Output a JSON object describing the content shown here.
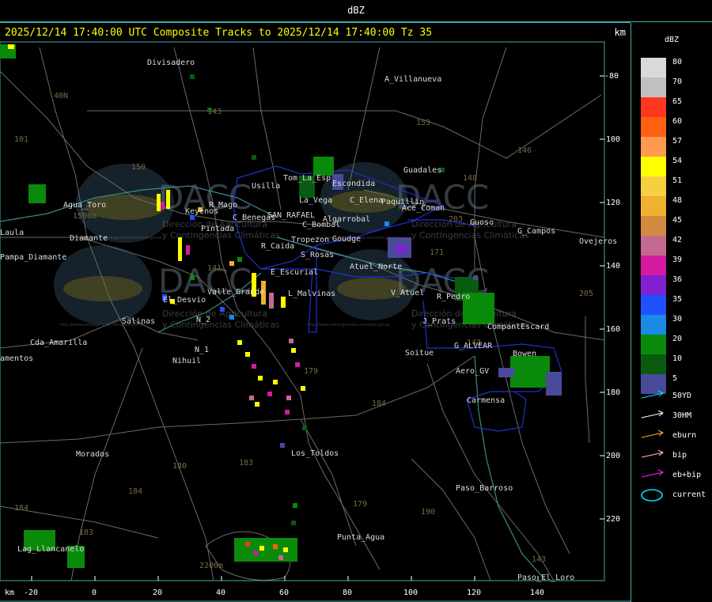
{
  "window_title": "dBZ",
  "header": {
    "title": "2025/12/14 17:40:00 UTC Composite Tracks to 2025/12/14 17:40:00 Tz 35",
    "km_label": "km"
  },
  "axes": {
    "x_unit": "km",
    "y_unit": "km",
    "x_ticks": [
      "-20",
      "0",
      "20",
      "40",
      "60",
      "80",
      "100",
      "120",
      "140"
    ],
    "y_ticks": [
      "-80",
      "-100",
      "-120",
      "-140",
      "-160",
      "-180",
      "-200",
      "-220"
    ]
  },
  "legend": {
    "title": "dBZ",
    "entries": [
      {
        "label": "80",
        "color": "#d9d9d9"
      },
      {
        "label": "70",
        "color": "#c0c0c0"
      },
      {
        "label": "65",
        "color": "#ff3620"
      },
      {
        "label": "60",
        "color": "#ff6010"
      },
      {
        "label": "57",
        "color": "#ff9a50"
      },
      {
        "label": "54",
        "color": "#ffff00"
      },
      {
        "label": "51",
        "color": "#f6d040"
      },
      {
        "label": "48",
        "color": "#f0b030"
      },
      {
        "label": "45",
        "color": "#d28a40"
      },
      {
        "label": "42",
        "color": "#c46a90"
      },
      {
        "label": "39",
        "color": "#d41aa0"
      },
      {
        "label": "36",
        "color": "#8020d0"
      },
      {
        "label": "35",
        "color": "#2050ff"
      },
      {
        "label": "30",
        "color": "#1a8ae6"
      },
      {
        "label": "20",
        "color": "#0a8a0a"
      },
      {
        "label": "10",
        "color": "#0a5a10"
      },
      {
        "label": "5",
        "color": "#4a4a9a"
      }
    ]
  },
  "tracks": [
    {
      "label": "50YD",
      "color": "#00e5ff"
    },
    {
      "label": "30HM",
      "color": "#ffffff"
    },
    {
      "label": "eburn",
      "color": "#ffb020"
    },
    {
      "label": "bip",
      "color": "#ffc0c0"
    },
    {
      "label": "eb+bip",
      "color": "#ff20ff"
    },
    {
      "label": "current",
      "color": "#00e5ff"
    }
  ],
  "places": [
    "Divisadero",
    "A_Villanueva",
    "Usilla",
    "Tom_La_Esp",
    "La_Vega",
    "Escondida",
    "C_Elena",
    "Paquillin",
    "Ace_Coman",
    "Guadales",
    "Agua_Toro",
    "R_Mago",
    "Keyenos",
    "C_Benegas",
    "SAN_RAFAEL",
    "Algarrobal",
    "C_Bombal",
    "Goudge",
    "Pintada",
    "Tropezon",
    "Guoso",
    "G_Campos",
    "Ovejeros",
    "Pampa_Diamante",
    "R_Caida",
    "S_Rosas",
    "Atuel_Norte",
    "E_Escurial",
    "Valle_Grande",
    "L_Malvinas",
    "V_Atuel",
    "R_Pedro",
    "El_Desvio",
    "Salinas",
    "N_2",
    "J_Prats",
    "CompantEscard",
    "Cda_Amarilla",
    "N_1",
    "Nihuil",
    "Soitue",
    "G_ALVEAR",
    "Bowen",
    "Aero_GV",
    "Carmensa",
    "Morados",
    "Los_Toldos",
    "Paso_Barroso",
    "Punta_Agua",
    "Lag_Llancanelo",
    "Paso_El_Loro",
    "Diamante",
    "Laula",
    "amentos"
  ],
  "elevations": [
    "143",
    "153",
    "146",
    "148",
    "203",
    "171",
    "205",
    "141",
    "183",
    "143",
    "179",
    "184",
    "180",
    "184",
    "179",
    "190",
    "183",
    "184",
    "143",
    "101",
    "40N",
    "150",
    "1500m",
    "2200m"
  ],
  "watermark": {
    "brand": "DACC",
    "line1": "Dirección de Agricultura",
    "line2": "y Contingencias Climáticas",
    "url": "http://www.contingencias.mendoza.gov.ar"
  },
  "colors": {
    "frame": "#44aaaa",
    "header_text": "#ffff00",
    "boundary": "#2030d0"
  }
}
